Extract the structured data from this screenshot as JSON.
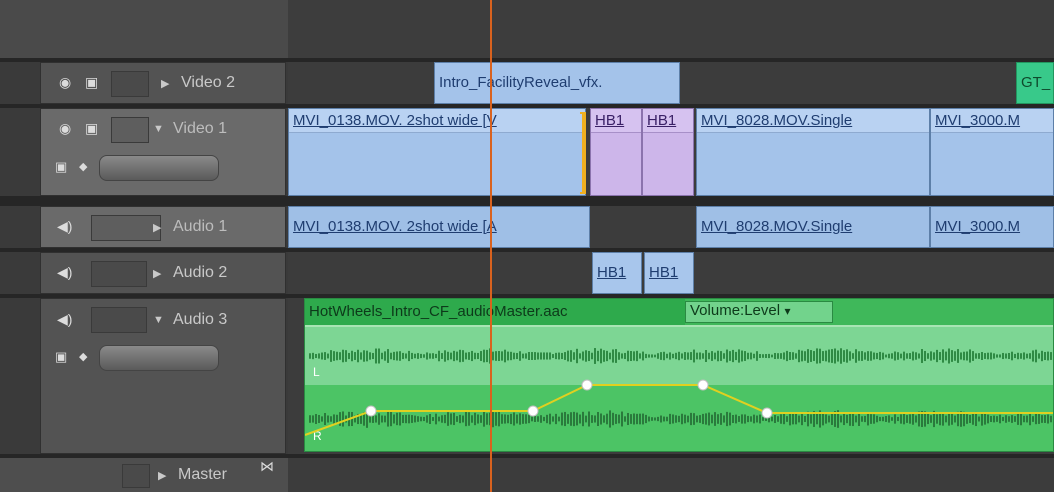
{
  "tracks": {
    "video2": {
      "label": "Video 2"
    },
    "video1": {
      "label": "Video 1"
    },
    "audio1": {
      "label": "Audio 1"
    },
    "audio2": {
      "label": "Audio 2"
    },
    "audio3": {
      "label": "Audio 3"
    },
    "master": {
      "label": "Master"
    }
  },
  "clips": {
    "v2_intro": "Intro_FacilityReveal_vfx.",
    "v2_gt": "GT_",
    "v1_mvi0138": "MVI_0138.MOV. 2shot wide [V",
    "v1_hb1a": "HB1",
    "v1_hb1b": "HB1",
    "v1_mvi8028": "MVI_8028.MOV.Single",
    "v1_mvi3000": "MVI_3000.M",
    "a1_mvi0138": "MVI_0138.MOV. 2shot wide [A",
    "a1_mvi8028": "MVI_8028.MOV.Single",
    "a1_mvi3000": "MVI_3000.M",
    "a2_hb1a": "HB1",
    "a2_hb1b": "HB1",
    "a3_master": "HotWheels_Intro_CF_audioMaster.aac",
    "a3_volume": "Volume:Level",
    "a3_channel_l": "L",
    "a3_channel_r": "R"
  },
  "icons": {
    "eye": "◉",
    "film": "▣",
    "speaker": "◀)",
    "expand": "▶",
    "collapse": "▼",
    "dropdown": "▾",
    "master_link": "⋈"
  },
  "colors": {
    "playhead": "#d9621e",
    "video_clip": "#a4c3ea",
    "nested_clip": "#cdb6ea",
    "audio_master_clip": "#3fb85a",
    "keyframe_line": "#e0d020"
  }
}
